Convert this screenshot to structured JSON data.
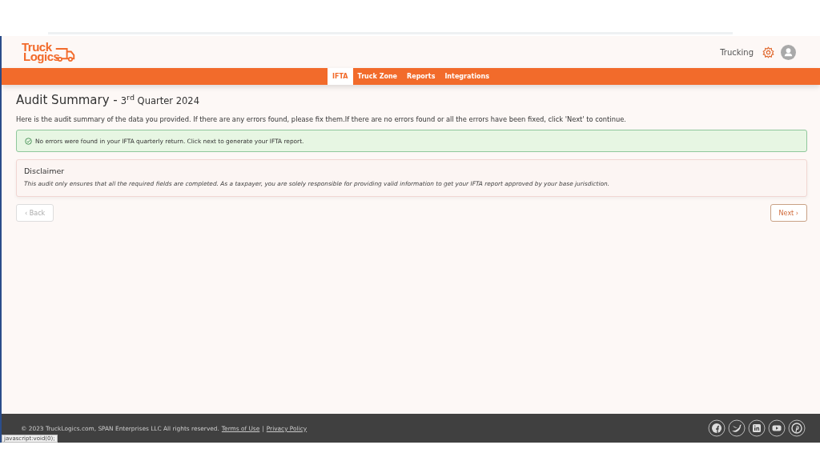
{
  "logo": {
    "line_1": "Truck",
    "line_2": "Logics"
  },
  "header": {
    "account": "Trucking"
  },
  "nav": [
    {
      "label": "IFTA",
      "selected": true
    },
    {
      "label": "Truck Zone",
      "selected": false
    },
    {
      "label": "Reports",
      "selected": false
    },
    {
      "label": "Integrations",
      "selected": false
    }
  ],
  "page": {
    "title": "Audit Summary - ",
    "period": "3$^{rd}$ Quarter 2024",
    "intro": "Here is the audit summary of the data you provided. If there are any errors found, please fix them.If there are no errors found or all the errors have been fixed, click 'Next' to continue.",
    "success": "No errors were found in your IFTA quarterly return. Click next to generate your IFTA report.",
    "disclaimer": {
      "title": "Disclaimer",
      "text": "This audit only ensures that all the required fields are completed. As a taxpayer, you are solely responsible for providing valid information to get your IFTA report approved by your base jurisdiction."
    },
    "back": "‹ Back",
    "next": "Next ›"
  },
  "footer": {
    "copyright": "© 2023 TruckLogics.com, SPAN Enterprises LLC All rights reserved.",
    "links": [
      "Terms of Use",
      "Privacy Policy"
    ],
    "separator": "|"
  },
  "status_url": "javascript:void(0);"
}
